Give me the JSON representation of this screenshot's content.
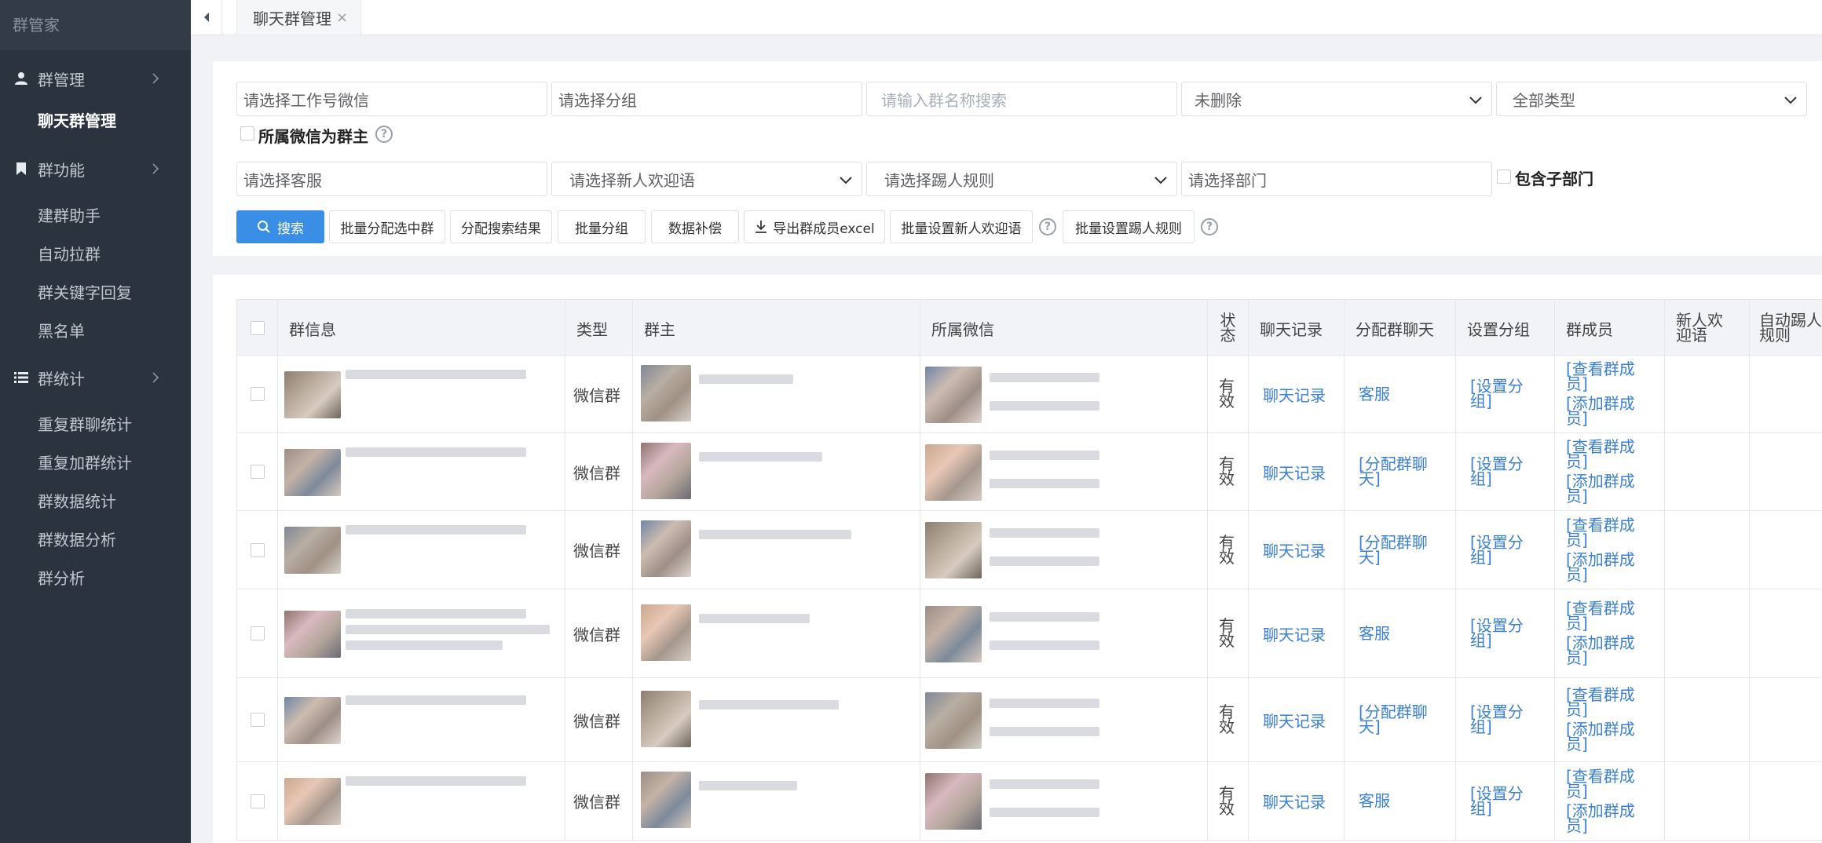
{
  "sidebar": {
    "brand": "群管家",
    "group_mgmt": "群管理",
    "chat_group_mgmt": "聊天群管理",
    "group_func": "群功能",
    "func_items": [
      "建群助手",
      "自动拉群",
      "群关键字回复",
      "黑名单"
    ],
    "group_stats": "群统计",
    "stats_items": [
      "重复群聊统计",
      "重复加群统计",
      "群数据统计",
      "群数据分析",
      "群分析"
    ]
  },
  "tabs": {
    "active": "聊天群管理",
    "close": "×"
  },
  "filters": {
    "wechat_ph": "请选择工作号微信",
    "group_ph": "请选择分组",
    "name_ph": "请输入群名称搜索",
    "deleted_value": "未删除",
    "type_value": "全部类型",
    "owner_checkbox": "所属微信为群主",
    "cs_ph": "请选择客服",
    "welcome_ph": "请选择新人欢迎语",
    "kick_ph": "请选择踢人规则",
    "dept_ph": "请选择部门",
    "sub_dept": "包含子部门"
  },
  "buttons": {
    "search": "搜索",
    "batch_assign": "批量分配选中群",
    "assign_results": "分配搜索结果",
    "batch_group": "批量分组",
    "data_fix": "数据补偿",
    "export": "导出群成员excel",
    "batch_welcome": "批量设置新人欢迎语",
    "batch_kick": "批量设置踢人规则"
  },
  "table": {
    "headers": {
      "info": "群信息",
      "type": "类型",
      "owner": "群主",
      "wechat": "所属微信",
      "status": "状态",
      "chat": "聊天记录",
      "assign": "分配群聊天",
      "setgroup": "设置分组",
      "members": "群成员",
      "welcome": "新人欢迎语",
      "kick": "自动踢人规则"
    },
    "status_text": "有效",
    "type_text": "微信群",
    "chat_link": "聊天记录",
    "assign_values": [
      "客服",
      "[分配群聊天]",
      "[分配群聊天]",
      "客服",
      "[分配群聊天]",
      "客服"
    ],
    "setgroup_link": "[设置分组]",
    "view_members": "[查看群成员]",
    "add_members": "[添加群成员]"
  },
  "colors": {
    "primary": "#3a8ee6",
    "link": "#3a7fd6",
    "sidebar": "#2b333e"
  }
}
